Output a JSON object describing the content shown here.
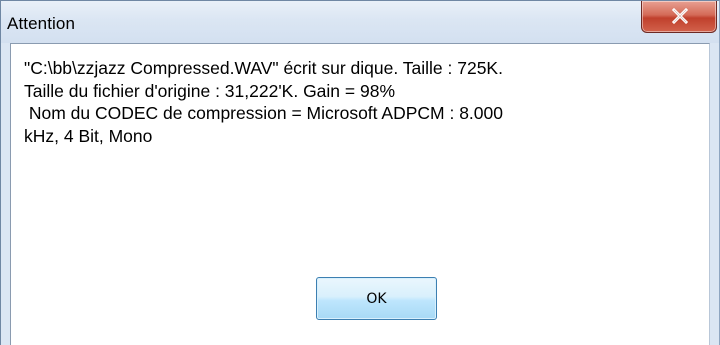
{
  "dialog": {
    "title": "Attention",
    "close_icon": "close-x-icon",
    "message_lines": [
      "\"C:\\bb\\zzjazz Compressed.WAV\" écrit sur dique. Taille : 725K.",
      "Taille du fichier d'origine : 31,222'K. Gain = 98%",
      " Nom du CODEC de compression = Microsoft ADPCM : 8.000",
      "kHz, 4 Bit, Mono"
    ],
    "ok_label": "OK"
  },
  "colors": {
    "titlebar": "#dbe6f3",
    "close_button": "#c7432f",
    "ok_button_border": "#3c7fb1"
  }
}
